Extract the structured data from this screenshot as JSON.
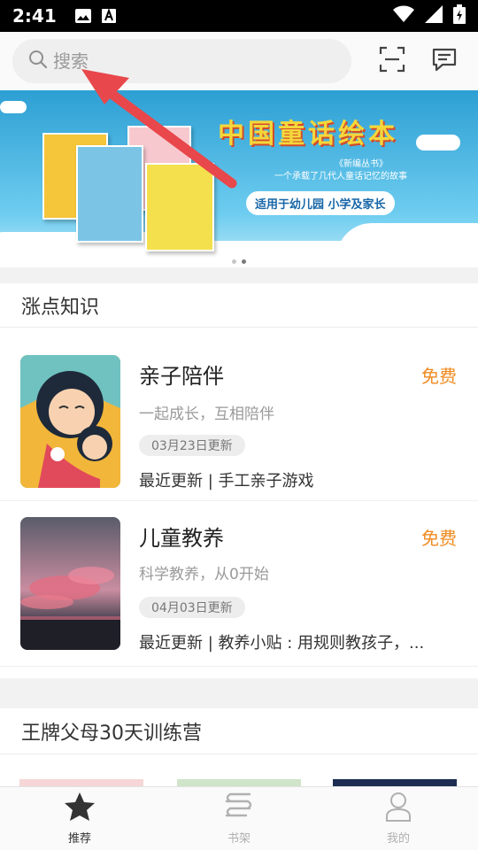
{
  "status_bar": {
    "time": "2:41"
  },
  "search": {
    "placeholder": "搜索"
  },
  "banner": {
    "title": "中国童话绘本",
    "subtitle": "一个承载了几代人童话记忆的故事",
    "series": "《新编丛书》",
    "tagline": "适用于幼儿园 小学及家长",
    "page_count": 2,
    "active_page": 2
  },
  "section_knowledge": {
    "title": "涨点知识",
    "cards": [
      {
        "title": "亲子陪伴",
        "price": "免费",
        "subtitle": "一起成长，互相陪伴",
        "updated": "03月23日更新",
        "latest": "最近更新 | 手工亲子游戏"
      },
      {
        "title": "儿童教养",
        "price": "免费",
        "subtitle": "科学教养，从0开始",
        "updated": "04月03日更新",
        "latest": "最近更新 | 教养小贴 : 用规则教孩子，..."
      }
    ]
  },
  "section_camp": {
    "title": "王牌父母30天训练营"
  },
  "tabbar": {
    "items": [
      {
        "label": "推荐",
        "icon": "star-icon",
        "active": true
      },
      {
        "label": "书架",
        "icon": "bookshelf-icon",
        "active": false
      },
      {
        "label": "我的",
        "icon": "person-icon",
        "active": false
      }
    ]
  },
  "colors": {
    "accent": "#f08b21",
    "arrow": "#e8474b"
  }
}
